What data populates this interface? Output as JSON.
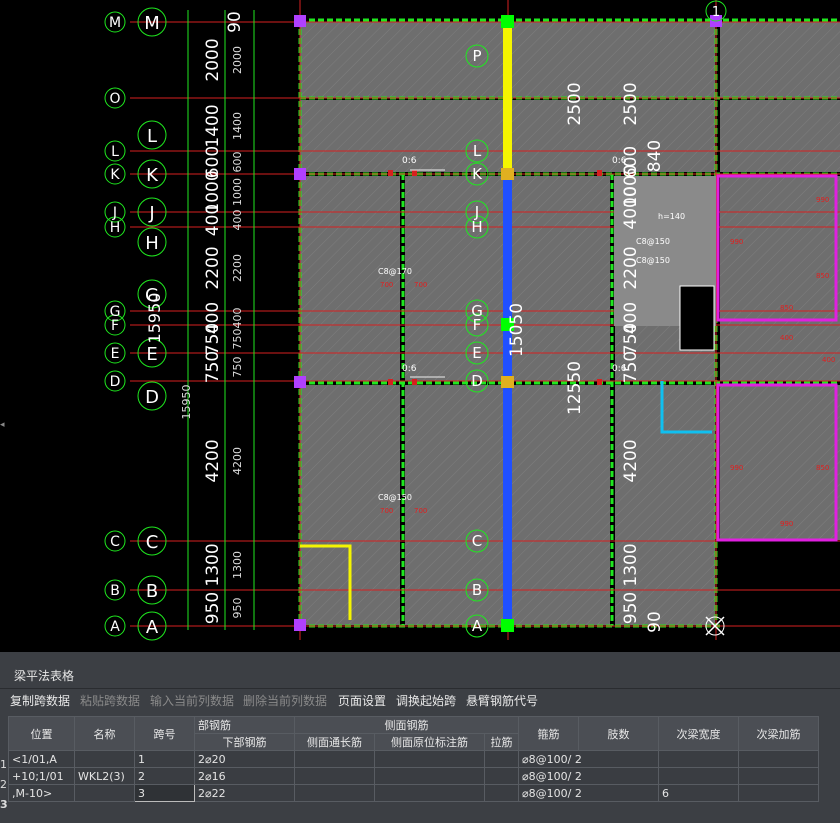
{
  "cad": {
    "left_axis_letters": [
      "M",
      "O",
      "L",
      "K",
      "J",
      "H",
      "G",
      "F",
      "E",
      "D",
      "C",
      "B",
      "A"
    ],
    "circle_labels": [
      "M",
      "L",
      "K",
      "J",
      "H",
      "G",
      "E",
      "D",
      "C",
      "B",
      "A"
    ],
    "center_axis_letters": [
      "P",
      "L",
      "K",
      "J",
      "H",
      "G",
      "F",
      "E",
      "D",
      "C",
      "B",
      "A"
    ],
    "top_axis_number": "1",
    "left_dims": [
      "90",
      "2000",
      "1400",
      "600",
      "1000",
      "400",
      "2200",
      "400",
      "750",
      "750",
      "4200",
      "1300",
      "950"
    ],
    "left_dims_small": [
      "2000",
      "1400",
      "600",
      "1000",
      "400",
      "2200",
      "400",
      "750",
      "750",
      "4200",
      "1300",
      "950"
    ],
    "total_height": "15950",
    "center_dims": [
      "2500",
      "2500",
      "840",
      "4000",
      "2200",
      "400",
      "750",
      "750",
      "4200",
      "1300",
      "950",
      "90"
    ],
    "center_right_labels": [
      "600",
      "1000"
    ],
    "mid_total": "15050",
    "mid_total_2": "12550",
    "slab_notes": [
      "C8@170",
      "C8@150",
      "C8@150",
      "C8@150"
    ],
    "slab_small": [
      "700",
      "700",
      "700",
      "700"
    ],
    "bar_notes": [
      "0:6",
      "0:6",
      "0:6",
      "0:6"
    ],
    "right_marks": [
      "990",
      "990",
      "850",
      "850",
      "990",
      "850",
      "990",
      "400",
      "400"
    ],
    "hole_label": "h=140"
  },
  "panel": {
    "title": "梁平法表格",
    "toolbar": [
      {
        "label": "复制跨数据",
        "enabled": true
      },
      {
        "label": "粘贴跨数据",
        "enabled": false
      },
      {
        "label": "输入当前列数据",
        "enabled": false
      },
      {
        "label": "删除当前列数据",
        "enabled": false
      },
      {
        "label": "页面设置",
        "enabled": true
      },
      {
        "label": "调换起始跨",
        "enabled": true
      },
      {
        "label": "悬臂钢筋代号",
        "enabled": true
      }
    ],
    "headers": {
      "position": "位置",
      "name": "名称",
      "span": "跨号",
      "bottom_group": "部钢筋",
      "bottom_bar": "下部钢筋",
      "side_group": "侧面钢筋",
      "side_through": "侧面通长筋",
      "side_mark": "侧面原位标注筋",
      "tie": "拉筋",
      "stirrup": "箍筋",
      "legs": "肢数",
      "sec_width": "次梁宽度",
      "sec_add": "次梁加筋"
    },
    "rows": [
      {
        "num": "1",
        "position": "<1/01,A",
        "name": "",
        "span": "1",
        "bottom": "2⌀20",
        "stirrup": "⌀8@100/ 2",
        "legs": "",
        "sec_width": "",
        "sec_add": ""
      },
      {
        "num": "2",
        "position": "+10;1/01",
        "name": "WKL2(3)",
        "span": "2",
        "bottom": "2⌀16",
        "stirrup": "⌀8@100/ 2",
        "legs": "",
        "sec_width": "",
        "sec_add": ""
      },
      {
        "num": "3",
        "position": ",M-10>",
        "name": "",
        "span": "3",
        "bottom": "2⌀22",
        "stirrup": "⌀8@100/ 2",
        "legs": "",
        "sec_width": "6",
        "sec_add": ""
      }
    ]
  }
}
